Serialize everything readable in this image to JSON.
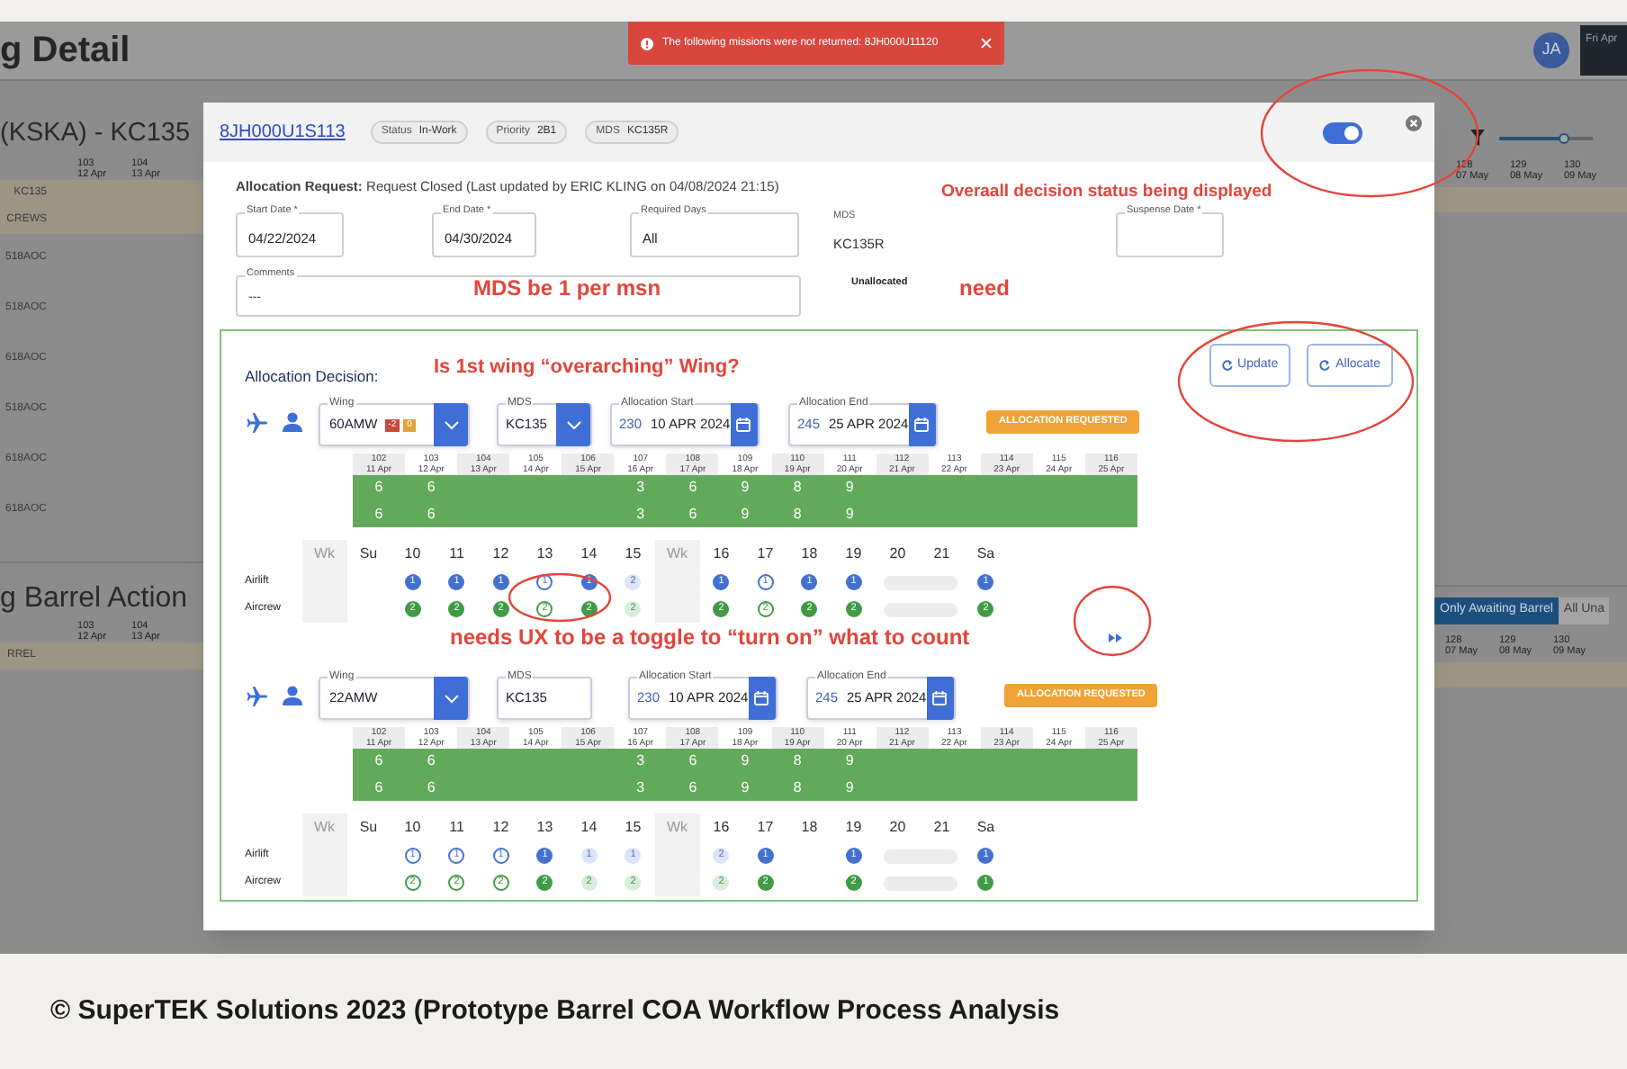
{
  "background": {
    "title": "g Detail",
    "avatar": "JA",
    "date_box": "Fri Apr",
    "toast": "The following missions were not returned: 8JH000U11120",
    "left": {
      "section_title": "(KSKA) - KC135",
      "dates": [
        {
          "day": "103",
          "date": "12 Apr"
        },
        {
          "day": "104",
          "date": "13 Apr"
        }
      ],
      "rows": [
        "KC135",
        "CREWS",
        "518AOC",
        "518AOC",
        "618AOC",
        "518AOC",
        "618AOC",
        "618AOC"
      ],
      "section2_title": "g Barrel Action",
      "dates2": [
        {
          "day": "103",
          "date": "12 Apr"
        },
        {
          "day": "104",
          "date": "13 Apr"
        }
      ],
      "rows2": [
        "RREL"
      ]
    },
    "right": {
      "slider": {
        "level": 0.7
      },
      "dates": [
        {
          "day": "128",
          "date": "07 May"
        },
        {
          "day": "129",
          "date": "08 May"
        },
        {
          "day": "130",
          "date": "09 May"
        }
      ],
      "tabs": [
        {
          "label": "Only Awaiting Barrel",
          "selected": true
        },
        {
          "label": "All Una",
          "selected": false
        }
      ],
      "dates2": [
        {
          "day": "128",
          "date": "07 May"
        },
        {
          "day": "129",
          "date": "08 May"
        },
        {
          "day": "130",
          "date": "09 May"
        }
      ]
    }
  },
  "modal": {
    "mission": "8JH000U1S113",
    "chips": [
      {
        "label": "Status",
        "value": "In-Work"
      },
      {
        "label": "Priority",
        "value": "2B1"
      },
      {
        "label": "MDS",
        "value": "KC135R"
      }
    ],
    "toggle": {
      "on": true
    },
    "request_line": "**Allocation Request:** Request Closed (Last updated by ERIC KLING on 04/08/2024 21:15)",
    "fields": [
      {
        "label": "Start Date *",
        "value": "04/22/2024",
        "kind": "outlined"
      },
      {
        "label": "End Date *",
        "value": "04/30/2024",
        "kind": "outlined"
      },
      {
        "label": "Required Days",
        "value": "All",
        "kind": "outlined"
      },
      {
        "label": "MDS",
        "value": "KC135R",
        "kind": "plain"
      },
      {
        "label": "Suspense Date *",
        "kind": "outlined"
      }
    ],
    "comments": {
      "label": "Comments",
      "value": "---"
    },
    "allocation_status": "Unallocated",
    "notes": {
      "status": "Overaall decision status being displayed",
      "mds": "MDS be  1 per msn",
      "need": "need",
      "wing": "Is 1st wing “overarching” Wing?",
      "toggle": "needs UX to be a toggle to “turn on” what to count"
    },
    "decision": {
      "title": "Allocation Decision:",
      "buttons": [
        "Update",
        "Allocate"
      ],
      "wings": [
        {
          "wing": {
            "label": "Wing",
            "value": "60AMW",
            "badges": [
              {
                "text": "-2",
                "color": "#c8483c"
              },
              {
                "text": "0",
                "color": "#e0a43c"
              }
            ]
          },
          "mds": {
            "label": "MDS",
            "value": "KC135",
            "dropdown": true
          },
          "start": {
            "label": "Allocation Start",
            "day": "230",
            "date": "10 APR 2024"
          },
          "end": {
            "label": "Allocation End",
            "day": "245",
            "date": "25 APR 2024"
          },
          "status": "ALLOCATION REQUESTED",
          "timeline": [
            {
              "day": "102",
              "date": "11 Apr",
              "counts": [
                "6",
                "6"
              ]
            },
            {
              "day": "103",
              "date": "12 Apr",
              "counts": [
                "6",
                "6"
              ]
            },
            {
              "day": "104",
              "date": "13 Apr"
            },
            {
              "day": "105",
              "date": "14 Apr"
            },
            {
              "day": "106",
              "date": "15 Apr"
            },
            {
              "day": "107",
              "date": "16 Apr",
              "counts": [
                "3",
                "3"
              ]
            },
            {
              "day": "108",
              "date": "17 Apr",
              "counts": [
                "6",
                "6"
              ]
            },
            {
              "day": "109",
              "date": "18 Apr",
              "counts": [
                "9",
                "9"
              ]
            },
            {
              "day": "110",
              "date": "19 Apr",
              "counts": [
                "8",
                "8"
              ]
            },
            {
              "day": "111",
              "date": "20 Apr",
              "counts": [
                "9",
                "9"
              ]
            },
            {
              "day": "112",
              "date": "21 Apr"
            },
            {
              "day": "113",
              "date": "22 Apr"
            },
            {
              "day": "114",
              "date": "23 Apr"
            },
            {
              "day": "115",
              "date": "24 Apr"
            },
            {
              "day": "116",
              "date": "25 Apr"
            }
          ],
          "columns": [
            {
              "label": "Wk",
              "kind": "wk"
            },
            {
              "label": "Su",
              "kind": "day"
            },
            {
              "label": "10",
              "kind": "day"
            },
            {
              "label": "11",
              "kind": "day"
            },
            {
              "label": "12",
              "kind": "day"
            },
            {
              "label": "13",
              "kind": "day"
            },
            {
              "label": "14",
              "kind": "day"
            },
            {
              "label": "15",
              "kind": "day"
            },
            {
              "label": "Wk",
              "kind": "wk"
            },
            {
              "label": "16",
              "kind": "day"
            },
            {
              "label": "17",
              "kind": "day"
            },
            {
              "label": "18",
              "kind": "day"
            },
            {
              "label": "19",
              "kind": "day"
            },
            {
              "label": "20",
              "kind": "day"
            },
            {
              "label": "21",
              "kind": "day"
            },
            {
              "label": "Sa",
              "kind": "day"
            }
          ],
          "rows": [
            {
              "label": "Airlift",
              "color": "#4471d0",
              "cells": [
                {
                  "kind": "wk"
                },
                {
                  "kind": "blank"
                },
                {
                  "kind": "filled",
                  "value": "1"
                },
                {
                  "kind": "filled",
                  "value": "1"
                },
                {
                  "kind": "filled",
                  "value": "1"
                },
                {
                  "kind": "outline",
                  "value": "1"
                },
                {
                  "kind": "filled",
                  "value": "1"
                },
                {
                  "kind": "light",
                  "value": "2"
                },
                {
                  "kind": "wk"
                },
                {
                  "kind": "filled",
                  "value": "1"
                },
                {
                  "kind": "outline",
                  "value": "1"
                },
                {
                  "kind": "filled",
                  "value": "1"
                },
                {
                  "kind": "filled",
                  "value": "1"
                },
                {
                  "kind": "pill"
                },
                {
                  "kind": "filled",
                  "value": "1"
                }
              ]
            },
            {
              "label": "Aircrew",
              "color": "#3f9b45",
              "cells": [
                {
                  "kind": "wk"
                },
                {
                  "kind": "blank"
                },
                {
                  "kind": "filled",
                  "value": "2"
                },
                {
                  "kind": "filled",
                  "value": "2"
                },
                {
                  "kind": "filled",
                  "value": "2"
                },
                {
                  "kind": "outline",
                  "value": "2"
                },
                {
                  "kind": "filled",
                  "value": "2"
                },
                {
                  "kind": "light",
                  "value": "2"
                },
                {
                  "kind": "wk"
                },
                {
                  "kind": "filled",
                  "value": "2"
                },
                {
                  "kind": "outline",
                  "value": "2"
                },
                {
                  "kind": "filled",
                  "value": "2"
                },
                {
                  "kind": "filled",
                  "value": "2"
                },
                {
                  "kind": "pill"
                },
                {
                  "kind": "filled",
                  "value": "2"
                }
              ]
            }
          ]
        },
        {
          "wing": {
            "label": "Wing",
            "value": "22AMW"
          },
          "mds": {
            "label": "MDS",
            "value": "KC135",
            "dropdown": false
          },
          "start": {
            "label": "Allocation Start",
            "day": "230",
            "date": "10 APR 2024"
          },
          "end": {
            "label": "Allocation End",
            "day": "245",
            "date": "25 APR 2024"
          },
          "status": "ALLOCATION REQUESTED",
          "timeline": [
            {
              "day": "102",
              "date": "11 Apr",
              "counts": [
                "6",
                "6"
              ]
            },
            {
              "day": "103",
              "date": "12 Apr",
              "counts": [
                "6",
                "6"
              ]
            },
            {
              "day": "104",
              "date": "13 Apr"
            },
            {
              "day": "105",
              "date": "14 Apr"
            },
            {
              "day": "106",
              "date": "15 Apr"
            },
            {
              "day": "107",
              "date": "16 Apr",
              "counts": [
                "3",
                "3"
              ]
            },
            {
              "day": "108",
              "date": "17 Apr",
              "counts": [
                "6",
                "6"
              ]
            },
            {
              "day": "109",
              "date": "18 Apr",
              "counts": [
                "9",
                "9"
              ]
            },
            {
              "day": "110",
              "date": "19 Apr",
              "counts": [
                "8",
                "8"
              ]
            },
            {
              "day": "111",
              "date": "20 Apr",
              "counts": [
                "9",
                "9"
              ]
            },
            {
              "day": "112",
              "date": "21 Apr"
            },
            {
              "day": "113",
              "date": "22 Apr"
            },
            {
              "day": "114",
              "date": "23 Apr"
            },
            {
              "day": "115",
              "date": "24 Apr"
            },
            {
              "day": "116",
              "date": "25 Apr"
            }
          ],
          "columns": [
            {
              "label": "Wk",
              "kind": "wk"
            },
            {
              "label": "Su",
              "kind": "day"
            },
            {
              "label": "10",
              "kind": "day"
            },
            {
              "label": "11",
              "kind": "day"
            },
            {
              "label": "12",
              "kind": "day"
            },
            {
              "label": "13",
              "kind": "day"
            },
            {
              "label": "14",
              "kind": "day"
            },
            {
              "label": "15",
              "kind": "day"
            },
            {
              "label": "Wk",
              "kind": "wk"
            },
            {
              "label": "16",
              "kind": "day"
            },
            {
              "label": "17",
              "kind": "day"
            },
            {
              "label": "18",
              "kind": "day"
            },
            {
              "label": "19",
              "kind": "day"
            },
            {
              "label": "20",
              "kind": "day"
            },
            {
              "label": "21",
              "kind": "day"
            },
            {
              "label": "Sa",
              "kind": "day"
            }
          ],
          "rows": [
            {
              "label": "Airlift",
              "color": "#4471d0",
              "cells": [
                {
                  "kind": "wk"
                },
                {
                  "kind": "blank"
                },
                {
                  "kind": "outline",
                  "value": "1"
                },
                {
                  "kind": "outline",
                  "value": "1"
                },
                {
                  "kind": "outline",
                  "value": "1"
                },
                {
                  "kind": "filled",
                  "value": "1"
                },
                {
                  "kind": "light",
                  "value": "1"
                },
                {
                  "kind": "light",
                  "value": "1"
                },
                {
                  "kind": "wk"
                },
                {
                  "kind": "light",
                  "value": "2"
                },
                {
                  "kind": "filled",
                  "value": "1"
                },
                {
                  "kind": "blank"
                },
                {
                  "kind": "filled",
                  "value": "1"
                },
                {
                  "kind": "pill"
                },
                {
                  "kind": "filled",
                  "value": "1"
                }
              ]
            },
            {
              "label": "Aircrew",
              "color": "#3f9b45",
              "cells": [
                {
                  "kind": "wk"
                },
                {
                  "kind": "blank"
                },
                {
                  "kind": "outline",
                  "value": "2"
                },
                {
                  "kind": "outline",
                  "value": "2"
                },
                {
                  "kind": "outline",
                  "value": "2"
                },
                {
                  "kind": "filled",
                  "value": "2"
                },
                {
                  "kind": "light",
                  "value": "2"
                },
                {
                  "kind": "light",
                  "value": "2"
                },
                {
                  "kind": "wk"
                },
                {
                  "kind": "light",
                  "value": "2"
                },
                {
                  "kind": "filled",
                  "value": "2"
                },
                {
                  "kind": "blank"
                },
                {
                  "kind": "filled",
                  "value": "2"
                },
                {
                  "kind": "pill"
                },
                {
                  "kind": "filled",
                  "value": "1"
                }
              ]
            }
          ]
        }
      ]
    }
  },
  "caption": "© SuperTEK Solutions 2023 (Prototype Barrel COA Workflow Process Analysis"
}
